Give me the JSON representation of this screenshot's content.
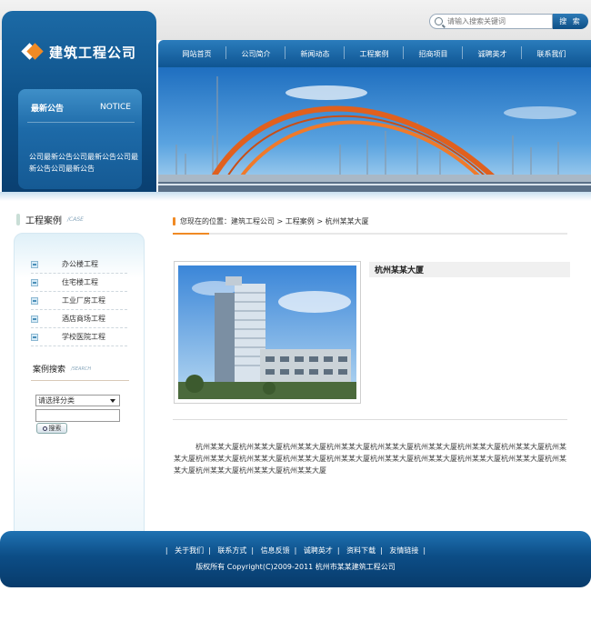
{
  "brand": {
    "name": "建筑工程公司"
  },
  "search": {
    "placeholder": "请输入搜索关键词",
    "button": "搜 索"
  },
  "nav": {
    "items": [
      "网站首页",
      "公司简介",
      "新闻动态",
      "工程案例",
      "招商项目",
      "诚聘英才",
      "联系我们"
    ]
  },
  "notice": {
    "title": "最新公告",
    "title_en": "NOTICE",
    "body": "公司最新公告公司最新公告公司最新公告公司最新公告"
  },
  "sidebar": {
    "case_title": "工程案例",
    "case_title_en": "/CASE",
    "cases": [
      "办公楼工程",
      "住宅楼工程",
      "工业厂房工程",
      "酒店商场工程",
      "学校医院工程"
    ],
    "search_title": "案例搜索",
    "search_title_en": "/SEARCH",
    "select_value": "请选择分类",
    "search_button": "搜索"
  },
  "breadcrumb": {
    "text": "您现在的位置：建筑工程公司 > 工程案例 > 杭州某某大厦"
  },
  "item": {
    "title": "杭州某某大厦",
    "description": "杭州某某大厦杭州某某大厦杭州某某大厦杭州某某大厦杭州某某大厦杭州某某大厦杭州某某大厦杭州某某大厦杭州某某大厦杭州某某大厦杭州某某大厦杭州某某大厦杭州某某大厦杭州某某大厦杭州某某大厦杭州某某大厦杭州某某大厦杭州某某大厦杭州某某大厦杭州某某大厦杭州某某大厦"
  },
  "footer": {
    "links": [
      "关于我们",
      "联系方式",
      "信息反馈",
      "诚聘英才",
      "资料下载",
      "友情链接"
    ],
    "copyright": "版权所有  Copyright(C)2009-2011 杭州市某某建筑工程公司"
  },
  "colors": {
    "primary": "#0d4f86",
    "accent": "#f08a24"
  }
}
